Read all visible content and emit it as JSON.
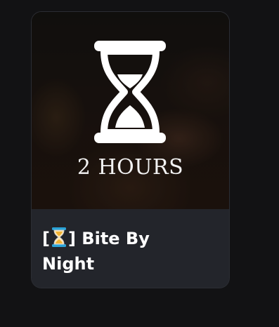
{
  "card": {
    "overlay_text": "2 HOURS",
    "title_open_bracket": "[",
    "title_close_bracket": "]",
    "title_emoji": "hourglass-emoji-icon",
    "title_line1": " Bite By",
    "title_line2": "Night"
  },
  "colors": {
    "page_bg": "#121214",
    "card_bg": "#23252b",
    "text": "#ffffff",
    "emoji_frame": "#2aa3d8",
    "emoji_sand": "#f2b233"
  }
}
